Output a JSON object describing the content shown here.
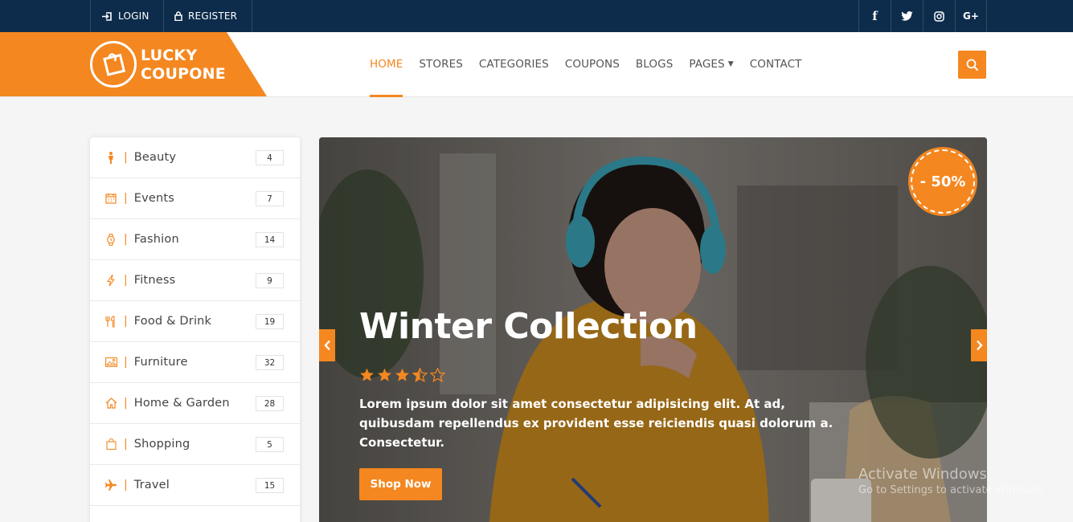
{
  "topbar": {
    "login_label": "LOGIN",
    "register_label": "REGISTER",
    "social": [
      "f",
      "t",
      "ig",
      "G+"
    ]
  },
  "header": {
    "logo_line1": "LUCKY",
    "logo_line2": "COUPONE",
    "nav": [
      {
        "label": "HOME",
        "active": true
      },
      {
        "label": "STORES"
      },
      {
        "label": "CATEGORIES"
      },
      {
        "label": "COUPONS"
      },
      {
        "label": "BLOGS"
      },
      {
        "label": "PAGES"
      },
      {
        "label": "CONTACT"
      }
    ],
    "search_icon": "search-icon"
  },
  "sidebar": {
    "items": [
      {
        "label": "Beauty",
        "count": "4",
        "icon": "person-icon"
      },
      {
        "label": "Events",
        "count": "7",
        "icon": "calendar-icon"
      },
      {
        "label": "Fashion",
        "count": "14",
        "icon": "watch-icon"
      },
      {
        "label": "Fitness",
        "count": "9",
        "icon": "bolt-icon"
      },
      {
        "label": "Food & Drink",
        "count": "19",
        "icon": "utensils-icon"
      },
      {
        "label": "Furniture",
        "count": "32",
        "icon": "image-icon"
      },
      {
        "label": "Home & Garden",
        "count": "28",
        "icon": "home-icon"
      },
      {
        "label": "Shopping",
        "count": "5",
        "icon": "bag-icon"
      },
      {
        "label": "Travel",
        "count": "15",
        "icon": "plane-icon"
      }
    ]
  },
  "slider": {
    "title": "Winter Collection",
    "rating": 3.5,
    "text": "Lorem ipsum dolor sit amet consectetur adipisicing elit. At ad, quibusdam repellendus ex provident esse reiciendis quasi dolorum a. Consectetur.",
    "button": "Shop Now",
    "discount": "- 50%"
  },
  "watermark": {
    "line1": "Activate Windows",
    "line2": "Go to Settings to activate Windows."
  },
  "colors": {
    "accent": "#f48720",
    "topbar": "#0d2c4b"
  }
}
